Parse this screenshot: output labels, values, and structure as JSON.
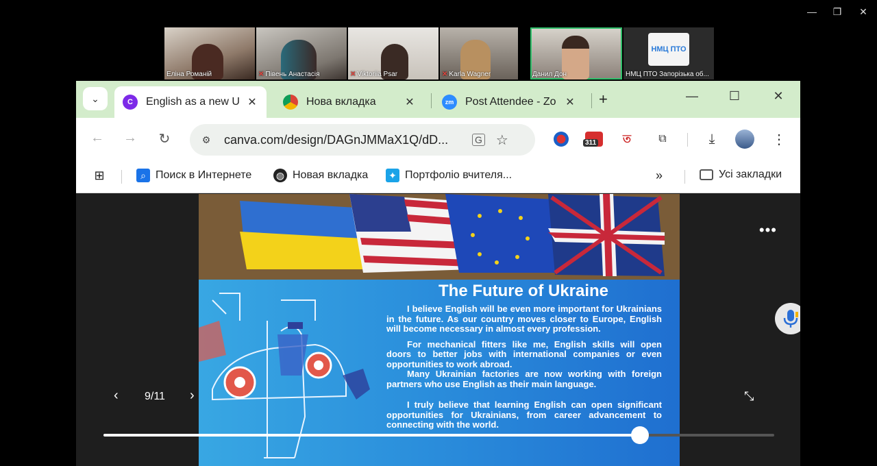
{
  "outer_window": {
    "minimize": "—",
    "restore": "❐",
    "close": "✕"
  },
  "participants": [
    {
      "name": "Еліна Романій",
      "muted": false
    },
    {
      "name": "Півень Анастасія",
      "muted": true
    },
    {
      "name": "Viktoriia Psar",
      "muted": true
    },
    {
      "name": "Karla Wagner",
      "muted": true
    },
    {
      "name": "Данил Дон",
      "muted": false,
      "active": true
    },
    {
      "name": "НМЦ ПТО Запорізька об...",
      "muted": false,
      "logo_text": "НМЦ ПТО"
    }
  ],
  "browser": {
    "tabs": [
      {
        "title": "English as a new U",
        "icon": "canva-icon",
        "icon_glyph": "C"
      },
      {
        "title": "Нова вкладка",
        "icon": "chrome-icon",
        "icon_glyph": ""
      },
      {
        "title": "Post Attendee - Zo",
        "icon": "zoom-icon",
        "icon_glyph": "zm"
      }
    ],
    "url": "canva.com/design/DAGnJMMaX1Q/dD...",
    "extension_badge": "311",
    "bookmarks": [
      {
        "label": "Поиск в Интернете",
        "icon": "search-icon"
      },
      {
        "label": "Новая вкладка",
        "icon": "globe-icon"
      },
      {
        "label": "Портфоліо вчителя...",
        "icon": "puzzle-icon"
      }
    ],
    "all_bookmarks": "Усі закладки"
  },
  "slide": {
    "title": "The Future of Ukraine",
    "paragraphs": [
      "I believe English will be even more important for Ukrainians in the future. As our country moves closer to Europe, English will become necessary in almost every profession.",
      "For mechanical fitters like me, English skills will open doors to better jobs with international companies or even opportunities to work abroad.",
      "Many Ukrainian factories are now working with foreign partners who use English as their main language.",
      "I truly believe that learning English can open significant opportunities for Ukrainians, from career advancement to connecting with the world."
    ]
  },
  "viewer": {
    "page_indicator": "9/11",
    "progress_fraction": 0.8,
    "more": "•••"
  },
  "colors": {
    "tabbar": "#d3eccb",
    "active_speaker": "#2fbf6a",
    "slide_blue": "#2b8fdc"
  }
}
